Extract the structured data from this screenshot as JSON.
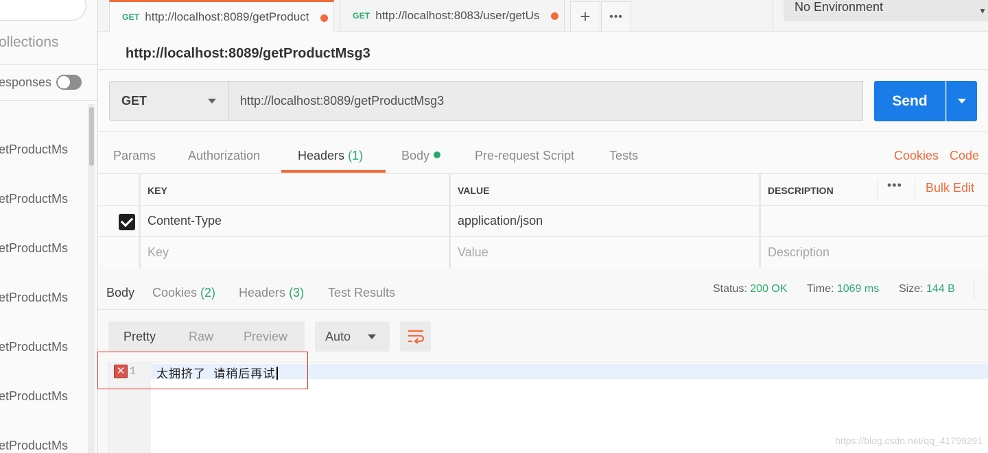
{
  "sidebar": {
    "collections_label": "ollections",
    "save_responses_label": "esponses",
    "save_responses_toggle": false,
    "items": [
      {
        "label": "etProductMs"
      },
      {
        "label": "etProductMs"
      },
      {
        "label": "etProductMs"
      },
      {
        "label": "etProductMs"
      },
      {
        "label": "etProductMs"
      },
      {
        "label": "etProductMs"
      },
      {
        "label": "etProductMs"
      }
    ]
  },
  "tabs": [
    {
      "method": "GET",
      "url": "http://localhost:8089/getProduct",
      "active": true,
      "unsaved": true
    },
    {
      "method": "GET",
      "url": "http://localhost:8083/user/getUs",
      "active": false,
      "unsaved": true
    }
  ],
  "tab_actions": {
    "add": "+",
    "more": "•••"
  },
  "environment": {
    "selected": "No Environment"
  },
  "request": {
    "title": "http://localhost:8089/getProductMsg3",
    "method": "GET",
    "url": "http://localhost:8089/getProductMsg3",
    "send_label": "Send"
  },
  "request_tabs": {
    "params": "Params",
    "authorization": "Authorization",
    "headers": "Headers",
    "headers_count": "(1)",
    "body": "Body",
    "prerequest": "Pre-request Script",
    "tests": "Tests",
    "cookies": "Cookies",
    "code": "Code",
    "active": "Headers"
  },
  "headers_table": {
    "columns": {
      "key": "KEY",
      "value": "VALUE",
      "description": "DESCRIPTION"
    },
    "bulk_edit": "Bulk Edit",
    "more": "•••",
    "rows": [
      {
        "checked": true,
        "key": "Content-Type",
        "value": "application/json",
        "description": ""
      }
    ],
    "placeholders": {
      "key": "Key",
      "value": "Value",
      "description": "Description"
    }
  },
  "response": {
    "tabs": {
      "body": "Body",
      "cookies": "Cookies",
      "cookies_count": "(2)",
      "headers": "Headers",
      "headers_count": "(3)",
      "test_results": "Test Results",
      "active": "Body"
    },
    "status_label": "Status:",
    "status_value": "200 OK",
    "time_label": "Time:",
    "time_value": "1069 ms",
    "size_label": "Size:",
    "size_value": "144 B",
    "view_modes": [
      "Pretty",
      "Raw",
      "Preview"
    ],
    "active_view": "Pretty",
    "format": "Auto",
    "line_number": "1",
    "content": "太拥挤了 请稍后再试"
  },
  "watermark": "https://blog.csdn.net/qq_41799291",
  "colors": {
    "accent": "#f26b3a",
    "send": "#1a7ce8",
    "success": "#2aa96c",
    "error": "#d9534f"
  }
}
